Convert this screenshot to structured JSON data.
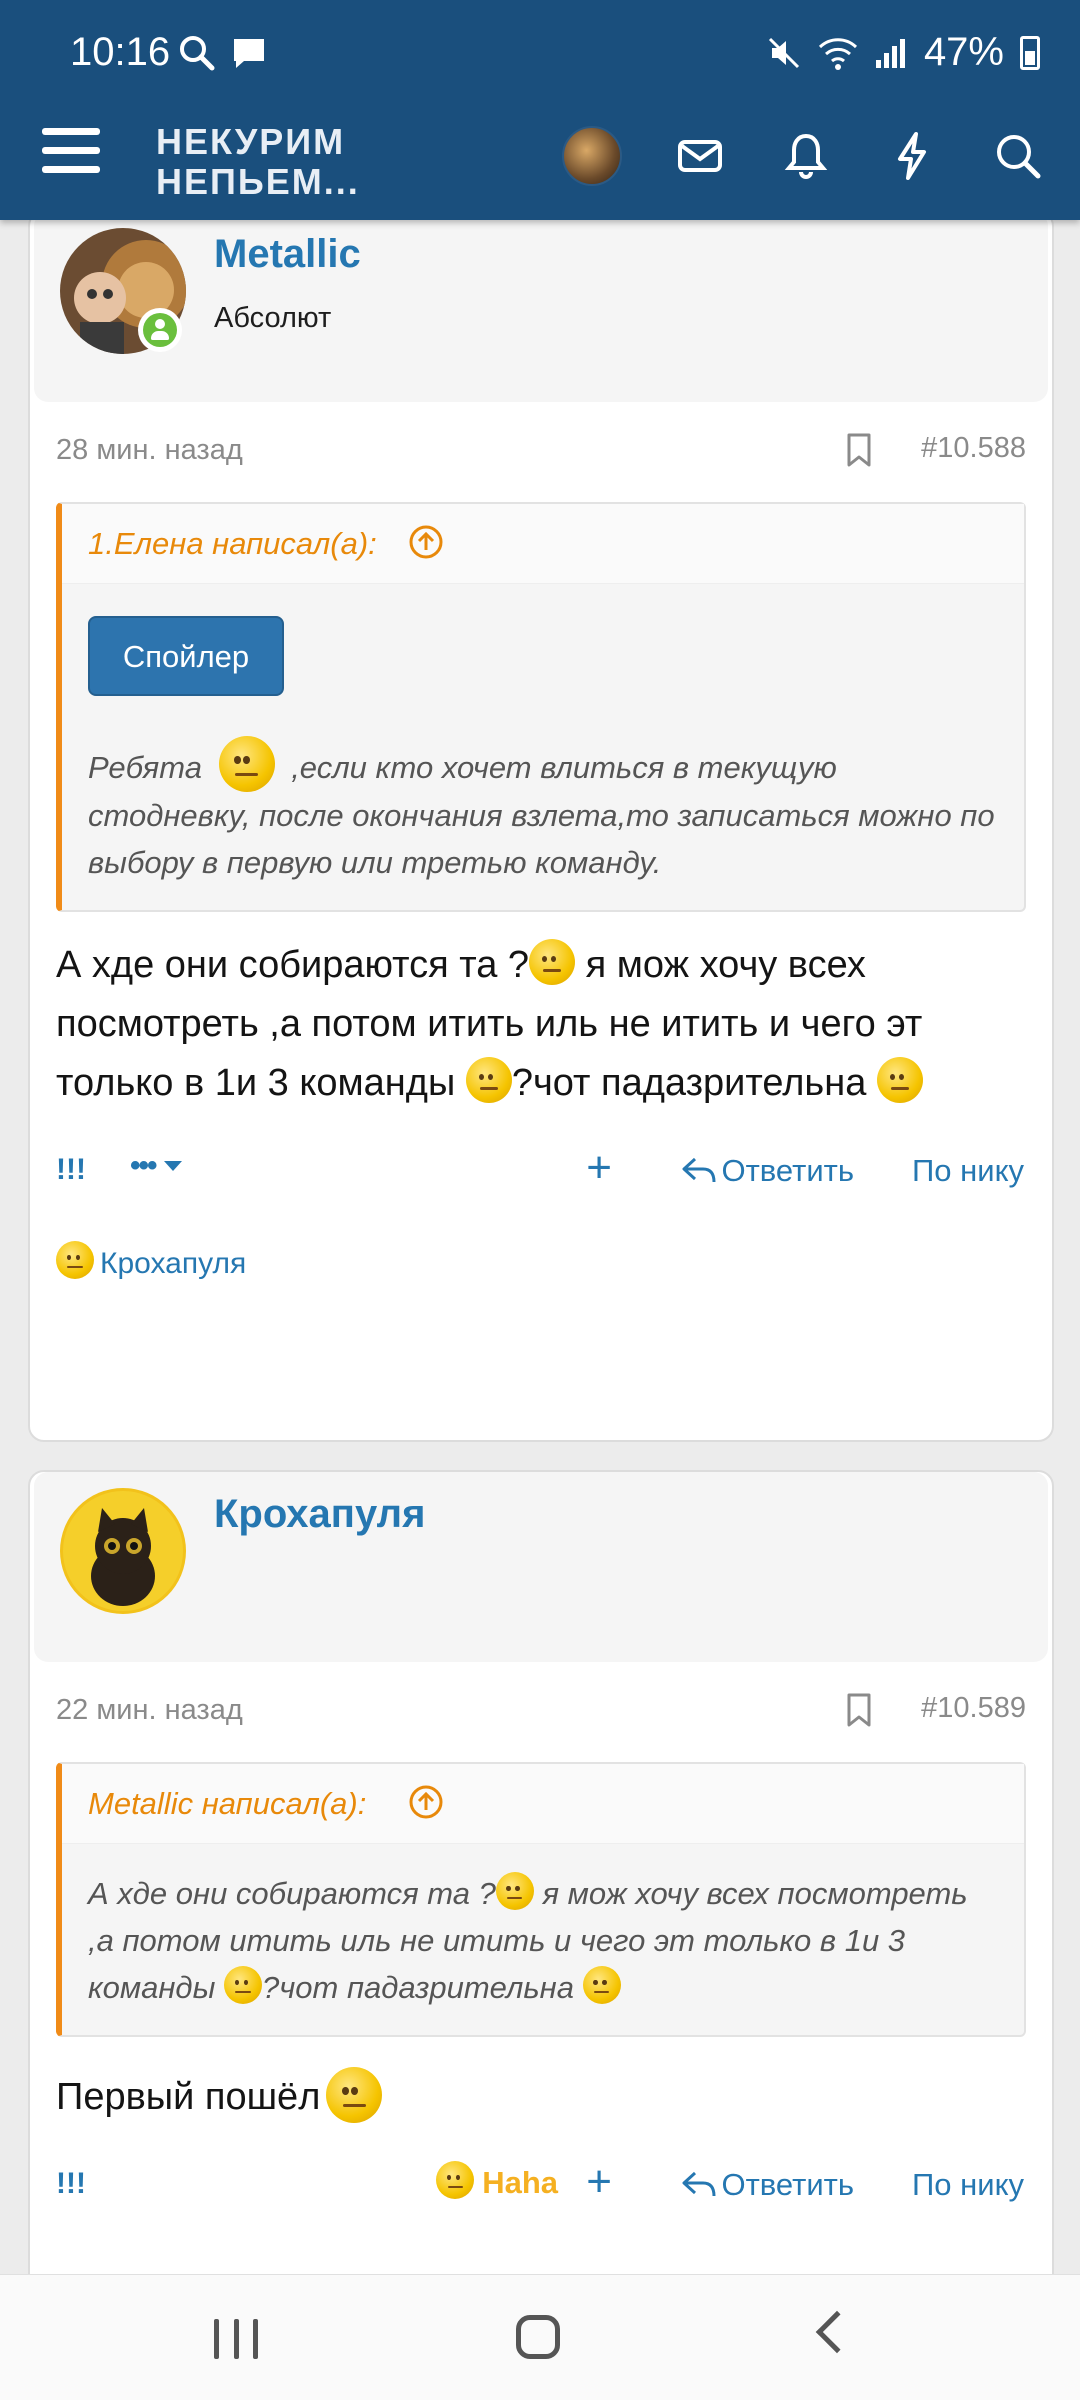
{
  "status": {
    "time": "10:16",
    "battery": "47%"
  },
  "header": {
    "logo_line1": "НЕКУРИМ",
    "logo_line2": "НЕПЬЕМ..."
  },
  "posts": [
    {
      "author": "Metallic",
      "user_title": "Абсолют",
      "time": "28 мин. назад",
      "number": "#10.588",
      "quote": {
        "author": "1.Елена написал(а):",
        "spoiler_label": "Спойлер",
        "text_before": "Ребята",
        "text_after": ",если кто хочет влиться в текущую стодневку, после окончания взлета,то записаться можно по выбору в первую или третью команду."
      },
      "text_part1": "А хде они собираются та ?",
      "text_part2": " я мож хочу всех посмотреть ,а потом итить иль не итить и чего эт только в 1и 3 команды ",
      "text_part3": "?чот падазрительна ",
      "actions": {
        "report": "!!!",
        "more": "•••",
        "reply": "Ответить",
        "by_nick": "По нику"
      },
      "reaction_user": "Крохапуля"
    },
    {
      "author": "Крохапуля",
      "time": "22 мин. назад",
      "number": "#10.589",
      "quote": {
        "author": "Metallic написал(а):",
        "text_part1": "А хде они собираются та ?",
        "text_part2": " я мож хочу всех посмотреть ,а потом итить иль не итить и чего эт только в 1и 3 команды ",
        "text_part3": "?чот падазрительна "
      },
      "text": "Первый пошёл",
      "actions": {
        "report": "!!!",
        "haha": "Haha",
        "reply": "Ответить",
        "by_nick": "По нику"
      }
    }
  ],
  "colors": {
    "header_bg": "#1a4f7d",
    "link": "#2577b1",
    "quote_accent": "#f08b18",
    "spoiler_bg": "#2d74ae"
  }
}
